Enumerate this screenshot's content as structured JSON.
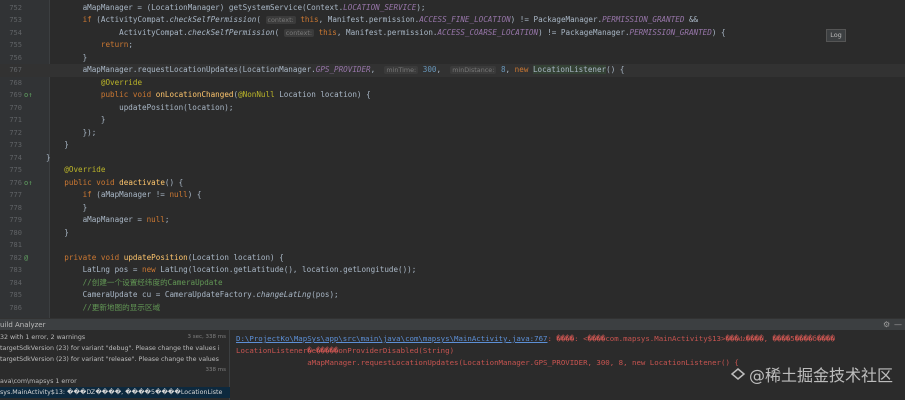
{
  "editor": {
    "lines": [
      {
        "num": "752",
        "html": "        aMapManager = (LocationManager) getSystemService(Context.<span class=\"st\">LOCATION_SERVICE</span>);"
      },
      {
        "num": "753",
        "html": "        <span class=\"kw\">if</span> (ActivityCompat.<span class=\"it\">checkSelfPermission</span>( <span class=\"hint\">context:</span> <span class=\"kw\">this</span>, Manifest.permission.<span class=\"st\">ACCESS_FINE_LOCATION</span>) != PackageManager.<span class=\"st\">PERMISSION_GRANTED</span> &amp;&amp;"
      },
      {
        "num": "754",
        "html": "                ActivityCompat.<span class=\"it\">checkSelfPermission</span>( <span class=\"hint\">context:</span> <span class=\"kw\">this</span>, Manifest.permission.<span class=\"st\">ACCESS_COARSE_LOCATION</span>) != PackageManager.<span class=\"st\">PERMISSION_GRANTED</span>) {"
      },
      {
        "num": "755",
        "html": "            <span class=\"kw\">return</span>;"
      },
      {
        "num": "756",
        "html": "        }"
      },
      {
        "num": "767",
        "html": "        aMapManager.requestLocationUpdates(LocationManager.<span class=\"st\">GPS_PROVIDER</span>,  <span class=\"hint\">minTime:</span> <span class=\"num\">300</span>,  <span class=\"hint\">minDistance:</span> <span class=\"num\">8</span>, <span class=\"kw\">new</span> <span class=\"ref\">LocationListener</span>() {",
        "caret": true
      },
      {
        "num": "768",
        "html": "            <span class=\"ann\">@Override</span>"
      },
      {
        "num": "769",
        "html": "            <span class=\"kw\">public void</span> <span class=\"fn\">onLocationChanged</span>(<span class=\"ann\">@NonNull</span> Location location) {",
        "mark": "o↑"
      },
      {
        "num": "770",
        "html": "                updatePosition(location);"
      },
      {
        "num": "771",
        "html": "            }"
      },
      {
        "num": "772",
        "html": "        });"
      },
      {
        "num": "773",
        "html": "    }"
      },
      {
        "num": "774",
        "html": "}"
      },
      {
        "num": "775",
        "html": "    <span class=\"ann\">@Override</span>"
      },
      {
        "num": "776",
        "html": "    <span class=\"kw\">public void</span> <span class=\"fn\">deactivate</span>() {",
        "mark": "o↑"
      },
      {
        "num": "777",
        "html": "        <span class=\"kw\">if</span> (aMapManager != <span class=\"kw\">null</span>) {"
      },
      {
        "num": "778",
        "html": "        }"
      },
      {
        "num": "779",
        "html": "        aMapManager = <span class=\"kw\">null</span>;"
      },
      {
        "num": "780",
        "html": "    }"
      },
      {
        "num": "781",
        "html": ""
      },
      {
        "num": "782",
        "html": "    <span class=\"kw\">private void</span> <span class=\"fn\">updatePosition</span>(Location location) {",
        "mark": "@"
      },
      {
        "num": "783",
        "html": "        LatLng pos = <span class=\"kw\">new</span> LatLng(location.getLatitude(), location.getLongitude());"
      },
      {
        "num": "784",
        "html": "        <span class=\"cm\">//创建一个设置经纬度的CameraUpdate</span>"
      },
      {
        "num": "785",
        "html": "        CameraUpdate cu = CameraUpdateFactory.<span class=\"it\">changeLatLng</span>(pos);"
      },
      {
        "num": "786",
        "html": "        <span class=\"cm\">//更新地图的显示区域</span>"
      }
    ],
    "log_button": "Log"
  },
  "tool_window": {
    "title": "uild Analyzer",
    "gear": "⚙",
    "minimize": "—"
  },
  "build_tree": [
    {
      "text": "32 with 1 error, 2 warnings",
      "right": "3 sec, 338 ms"
    },
    {
      "text": "targetSdkVersion (23) for variant \"debug\". Please change the values i",
      "right": ""
    },
    {
      "text": "targetSdkVersion (23) for variant \"release\". Please change the values",
      "right": ""
    },
    {
      "text": "",
      "right": "338 ms"
    },
    {
      "text": "ava\\com\\mapsys 1 error",
      "right": ""
    },
    {
      "text": "sys.MainActivity$13: ���Ǳ����, ����5����LocationListe",
      "right": "",
      "selected": true
    }
  ],
  "build_output": {
    "line1_link": "D:\\ProjectKo\\MapSys\\app\\src\\main\\java\\com\\mapsys\\MainActivity.java:767",
    "line1_rest": ": ����: <����com.mapsys.MainActivity$13>���ǳ����, ����5����δ����",
    "line2": "LocationListener�е�����onProviderDisabled(String)",
    "line3": "                aMapManager.requestLocationUpdates(LocationManager.GPS_PROVIDER, 300, 8, new LocationListener() {"
  },
  "watermark": {
    "text": "@稀土掘金技术社区"
  }
}
